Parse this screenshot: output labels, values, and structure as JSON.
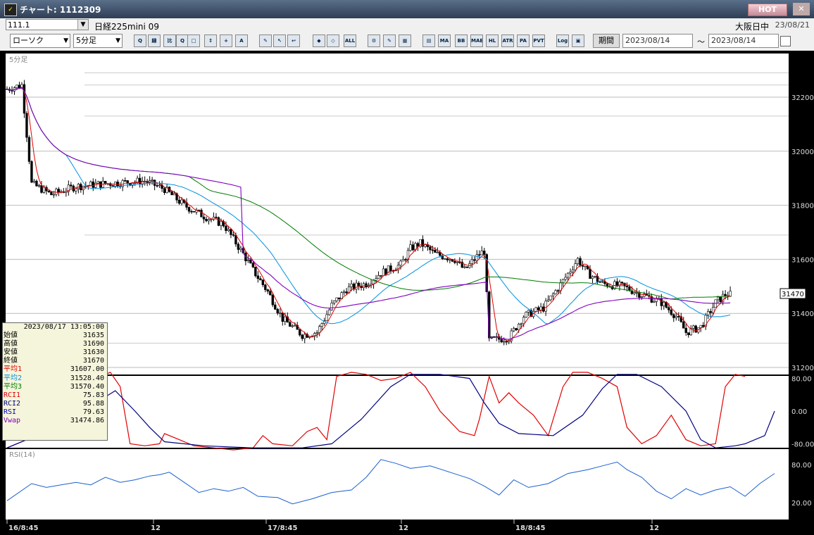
{
  "window": {
    "icon": "chart-app-icon",
    "title": "チャート: 1112309",
    "hot_label": "HOT",
    "close_label": "✕"
  },
  "header": {
    "code": "111.1",
    "instrument": "日経225mini 09",
    "market": "大阪日中",
    "date": "23/08/21"
  },
  "toolbar": {
    "chart_type": "ローソク",
    "interval": "5分足",
    "buttons": [
      "Q",
      "線",
      "比",
      "Q",
      "□",
      "↕",
      "+",
      "A",
      "✎",
      "↖",
      "↩",
      "◆",
      "◇",
      "ALL",
      "⚙",
      "✎",
      "▦",
      "▤",
      "MA",
      "BB",
      "MAE",
      "HL",
      "ATR",
      "PA",
      "PVT",
      "Log",
      "▣"
    ],
    "period_label": "期間",
    "from_date": "2023/08/14",
    "to_date": "2023/08/14",
    "tilde": "～"
  },
  "panes": {
    "main_label": "5分足",
    "osc_label": "",
    "rsi_label": "RSI(14)"
  },
  "info": {
    "datetime": "2023/08/17  13:05:00",
    "rows": [
      {
        "k": "始値",
        "v": "31635",
        "c": "#000"
      },
      {
        "k": "高値",
        "v": "31690",
        "c": "#000"
      },
      {
        "k": "安値",
        "v": "31630",
        "c": "#000"
      },
      {
        "k": "終値",
        "v": "31670",
        "c": "#000"
      },
      {
        "k": "平均1",
        "v": "31607.00",
        "c": "#e00000"
      },
      {
        "k": "平均2",
        "v": "31528.40",
        "c": "#0090e0"
      },
      {
        "k": "平均3",
        "v": "31570.40",
        "c": "#007a00"
      },
      {
        "k": "RCI1",
        "v": "75.83",
        "c": "#e00000"
      },
      {
        "k": "RCI2",
        "v": "95.88",
        "c": "#000080"
      },
      {
        "k": "RSI",
        "v": "79.63",
        "c": "#0000c0"
      },
      {
        "k": "Vwap",
        "v": "31474.86",
        "c": "#8000c0"
      }
    ]
  },
  "chart_data": [
    {
      "type": "candlestick",
      "title": "5分足",
      "y_ticks": [
        "32200",
        "32000",
        "31800",
        "31600",
        "31400",
        "31200"
      ],
      "ylim": [
        31160,
        32280
      ],
      "x_ticks": [
        "16/8:45",
        "12",
        "17/8:45",
        "12",
        "18/8:45",
        "12"
      ],
      "current_value": "31470",
      "ohlc_anchor_points": [
        [
          0,
          32230
        ],
        [
          6,
          32245
        ],
        [
          10,
          31880
        ],
        [
          18,
          31840
        ],
        [
          28,
          31870
        ],
        [
          40,
          31880
        ],
        [
          56,
          31890
        ],
        [
          64,
          31860
        ],
        [
          72,
          31800
        ],
        [
          80,
          31760
        ],
        [
          88,
          31730
        ],
        [
          96,
          31620
        ],
        [
          100,
          31560
        ],
        [
          106,
          31480
        ],
        [
          112,
          31380
        ],
        [
          120,
          31320
        ],
        [
          126,
          31330
        ],
        [
          132,
          31430
        ],
        [
          138,
          31490
        ],
        [
          146,
          31510
        ],
        [
          152,
          31550
        ],
        [
          160,
          31580
        ],
        [
          164,
          31640
        ],
        [
          168,
          31660
        ],
        [
          174,
          31620
        ],
        [
          182,
          31600
        ],
        [
          186,
          31560
        ],
        [
          192,
          31620
        ],
        [
          194,
          31630
        ],
        [
          196,
          31300
        ],
        [
          204,
          31310
        ],
        [
          210,
          31390
        ],
        [
          218,
          31420
        ],
        [
          226,
          31520
        ],
        [
          232,
          31600
        ],
        [
          236,
          31550
        ],
        [
          242,
          31510
        ],
        [
          250,
          31500
        ],
        [
          258,
          31470
        ],
        [
          266,
          31440
        ],
        [
          272,
          31390
        ],
        [
          276,
          31330
        ],
        [
          282,
          31350
        ],
        [
          288,
          31440
        ],
        [
          292,
          31470
        ]
      ],
      "series": [
        {
          "name": "平均1",
          "color": "#e00000"
        },
        {
          "name": "平均2",
          "color": "#0090e0"
        },
        {
          "name": "平均3",
          "color": "#007a00"
        },
        {
          "name": "Vwap",
          "color": "#8000c0"
        }
      ]
    },
    {
      "type": "line",
      "title": "",
      "y_ticks": [
        "80.00",
        "0.00",
        "-80.00"
      ],
      "ylim": [
        -100,
        100
      ],
      "series": [
        {
          "name": "RCI1",
          "color": "#e00000",
          "points": [
            [
              0,
              -90
            ],
            [
              6,
              -75
            ],
            [
              12,
              -60
            ],
            [
              18,
              -10
            ],
            [
              22,
              60
            ],
            [
              26,
              10
            ],
            [
              30,
              60
            ],
            [
              34,
              15
            ],
            [
              38,
              85
            ],
            [
              42,
              95
            ],
            [
              46,
              60
            ],
            [
              50,
              -80
            ],
            [
              56,
              -85
            ],
            [
              62,
              -80
            ],
            [
              64,
              -55
            ],
            [
              70,
              -70
            ],
            [
              76,
              -85
            ],
            [
              84,
              -90
            ],
            [
              92,
              -95
            ],
            [
              100,
              -90
            ],
            [
              104,
              -60
            ],
            [
              108,
              -80
            ],
            [
              116,
              -85
            ],
            [
              122,
              -50
            ],
            [
              126,
              -40
            ],
            [
              130,
              -70
            ],
            [
              134,
              85
            ],
            [
              140,
              95
            ],
            [
              146,
              90
            ],
            [
              152,
              75
            ],
            [
              158,
              80
            ],
            [
              164,
              95
            ],
            [
              170,
              60
            ],
            [
              176,
              0
            ],
            [
              184,
              -50
            ],
            [
              190,
              -60
            ],
            [
              192,
              -20
            ],
            [
              196,
              85
            ],
            [
              200,
              20
            ],
            [
              204,
              45
            ],
            [
              208,
              20
            ],
            [
              214,
              -10
            ],
            [
              220,
              -60
            ],
            [
              226,
              60
            ],
            [
              230,
              95
            ],
            [
              236,
              95
            ],
            [
              242,
              80
            ],
            [
              248,
              60
            ],
            [
              252,
              -40
            ],
            [
              258,
              -80
            ],
            [
              264,
              -60
            ],
            [
              270,
              -10
            ],
            [
              276,
              -70
            ],
            [
              282,
              -85
            ],
            [
              288,
              -80
            ],
            [
              292,
              60
            ],
            [
              296,
              90
            ],
            [
              300,
              85
            ]
          ]
        },
        {
          "name": "RCI2",
          "color": "#000080",
          "points": [
            [
              0,
              -90
            ],
            [
              20,
              -40
            ],
            [
              36,
              20
            ],
            [
              44,
              50
            ],
            [
              52,
              0
            ],
            [
              58,
              -40
            ],
            [
              64,
              -75
            ],
            [
              80,
              -85
            ],
            [
              100,
              -90
            ],
            [
              120,
              -90
            ],
            [
              132,
              -80
            ],
            [
              144,
              -20
            ],
            [
              156,
              60
            ],
            [
              164,
              90
            ],
            [
              176,
              90
            ],
            [
              188,
              80
            ],
            [
              194,
              20
            ],
            [
              200,
              -30
            ],
            [
              208,
              -55
            ],
            [
              222,
              -60
            ],
            [
              234,
              -10
            ],
            [
              242,
              55
            ],
            [
              248,
              90
            ],
            [
              256,
              90
            ],
            [
              266,
              60
            ],
            [
              276,
              0
            ],
            [
              282,
              -70
            ],
            [
              288,
              -90
            ],
            [
              296,
              -85
            ],
            [
              300,
              -80
            ],
            [
              308,
              -60
            ],
            [
              312,
              0
            ]
          ]
        }
      ]
    },
    {
      "type": "line",
      "title": "RSI(14)",
      "y_ticks": [
        "80.00",
        "20.00"
      ],
      "ylim": [
        0,
        100
      ],
      "series": [
        {
          "name": "RSI",
          "color": "#1a5fd0",
          "points": [
            [
              0,
              23
            ],
            [
              10,
              50
            ],
            [
              16,
              44
            ],
            [
              22,
              48
            ],
            [
              28,
              52
            ],
            [
              34,
              48
            ],
            [
              40,
              60
            ],
            [
              46,
              52
            ],
            [
              52,
              56
            ],
            [
              58,
              62
            ],
            [
              62,
              64
            ],
            [
              66,
              68
            ],
            [
              72,
              52
            ],
            [
              78,
              36
            ],
            [
              84,
              42
            ],
            [
              90,
              38
            ],
            [
              96,
              44
            ],
            [
              102,
              30
            ],
            [
              110,
              28
            ],
            [
              116,
              18
            ],
            [
              124,
              26
            ],
            [
              132,
              36
            ],
            [
              140,
              40
            ],
            [
              146,
              60
            ],
            [
              152,
              88
            ],
            [
              158,
              82
            ],
            [
              164,
              74
            ],
            [
              172,
              78
            ],
            [
              180,
              68
            ],
            [
              188,
              58
            ],
            [
              194,
              46
            ],
            [
              200,
              32
            ],
            [
              206,
              56
            ],
            [
              212,
              44
            ],
            [
              220,
              50
            ],
            [
              228,
              66
            ],
            [
              236,
              72
            ],
            [
              242,
              78
            ],
            [
              248,
              84
            ],
            [
              252,
              72
            ],
            [
              258,
              60
            ],
            [
              264,
              38
            ],
            [
              270,
              26
            ],
            [
              276,
              42
            ],
            [
              282,
              32
            ],
            [
              288,
              40
            ],
            [
              294,
              45
            ],
            [
              300,
              30
            ],
            [
              306,
              50
            ],
            [
              312,
              66
            ]
          ]
        }
      ]
    }
  ]
}
